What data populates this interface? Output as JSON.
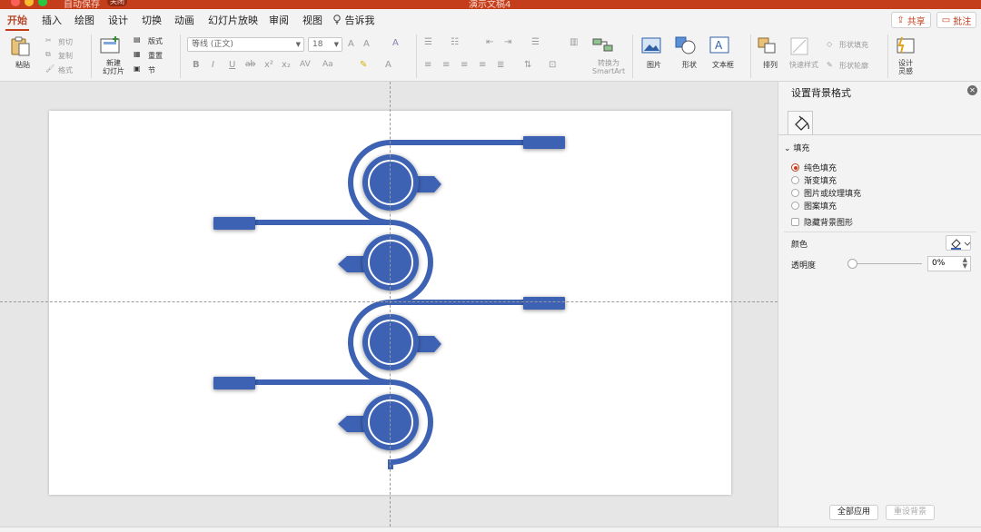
{
  "titlebar": {
    "autosave": "自动保存",
    "toggle": "关闭",
    "document_title": "演示文稿4"
  },
  "tabs": [
    "开始",
    "插入",
    "绘图",
    "设计",
    "切换",
    "动画",
    "幻灯片放映",
    "审阅",
    "视图",
    "告诉我"
  ],
  "top_buttons": {
    "share": "共享",
    "comment": "批注"
  },
  "ribbon": {
    "paste": "粘贴",
    "cut": "剪切",
    "copy": "复制",
    "format": "格式",
    "new_slide": "新建\n幻灯片",
    "layout": "版式",
    "reset": "重置",
    "section": "节",
    "font_name": "等线 (正文)",
    "font_size": "18",
    "smartart": "转换为\nSmartArt",
    "picture": "图片",
    "shape": "形状",
    "textbox": "文本框",
    "arrange": "排列",
    "quick_styles": "快速样式",
    "shape_fill": "形状填充",
    "shape_outline": "形状轮廓",
    "designer": "设计\n灵感"
  },
  "panel": {
    "title": "设置背景格式",
    "section_fill": "填充",
    "fill_options": [
      "纯色填充",
      "渐变填充",
      "图片或纹理填充",
      "图案填充"
    ],
    "selected_fill": 0,
    "hide_bg": "隐藏背景图形",
    "color": "颜色",
    "transparency": "透明度",
    "transparency_value": "0%",
    "apply_all": "全部应用",
    "reset_bg": "重设背景"
  },
  "colors": {
    "accent": "#c43e1c",
    "shape_blue": "#3d62b4"
  }
}
